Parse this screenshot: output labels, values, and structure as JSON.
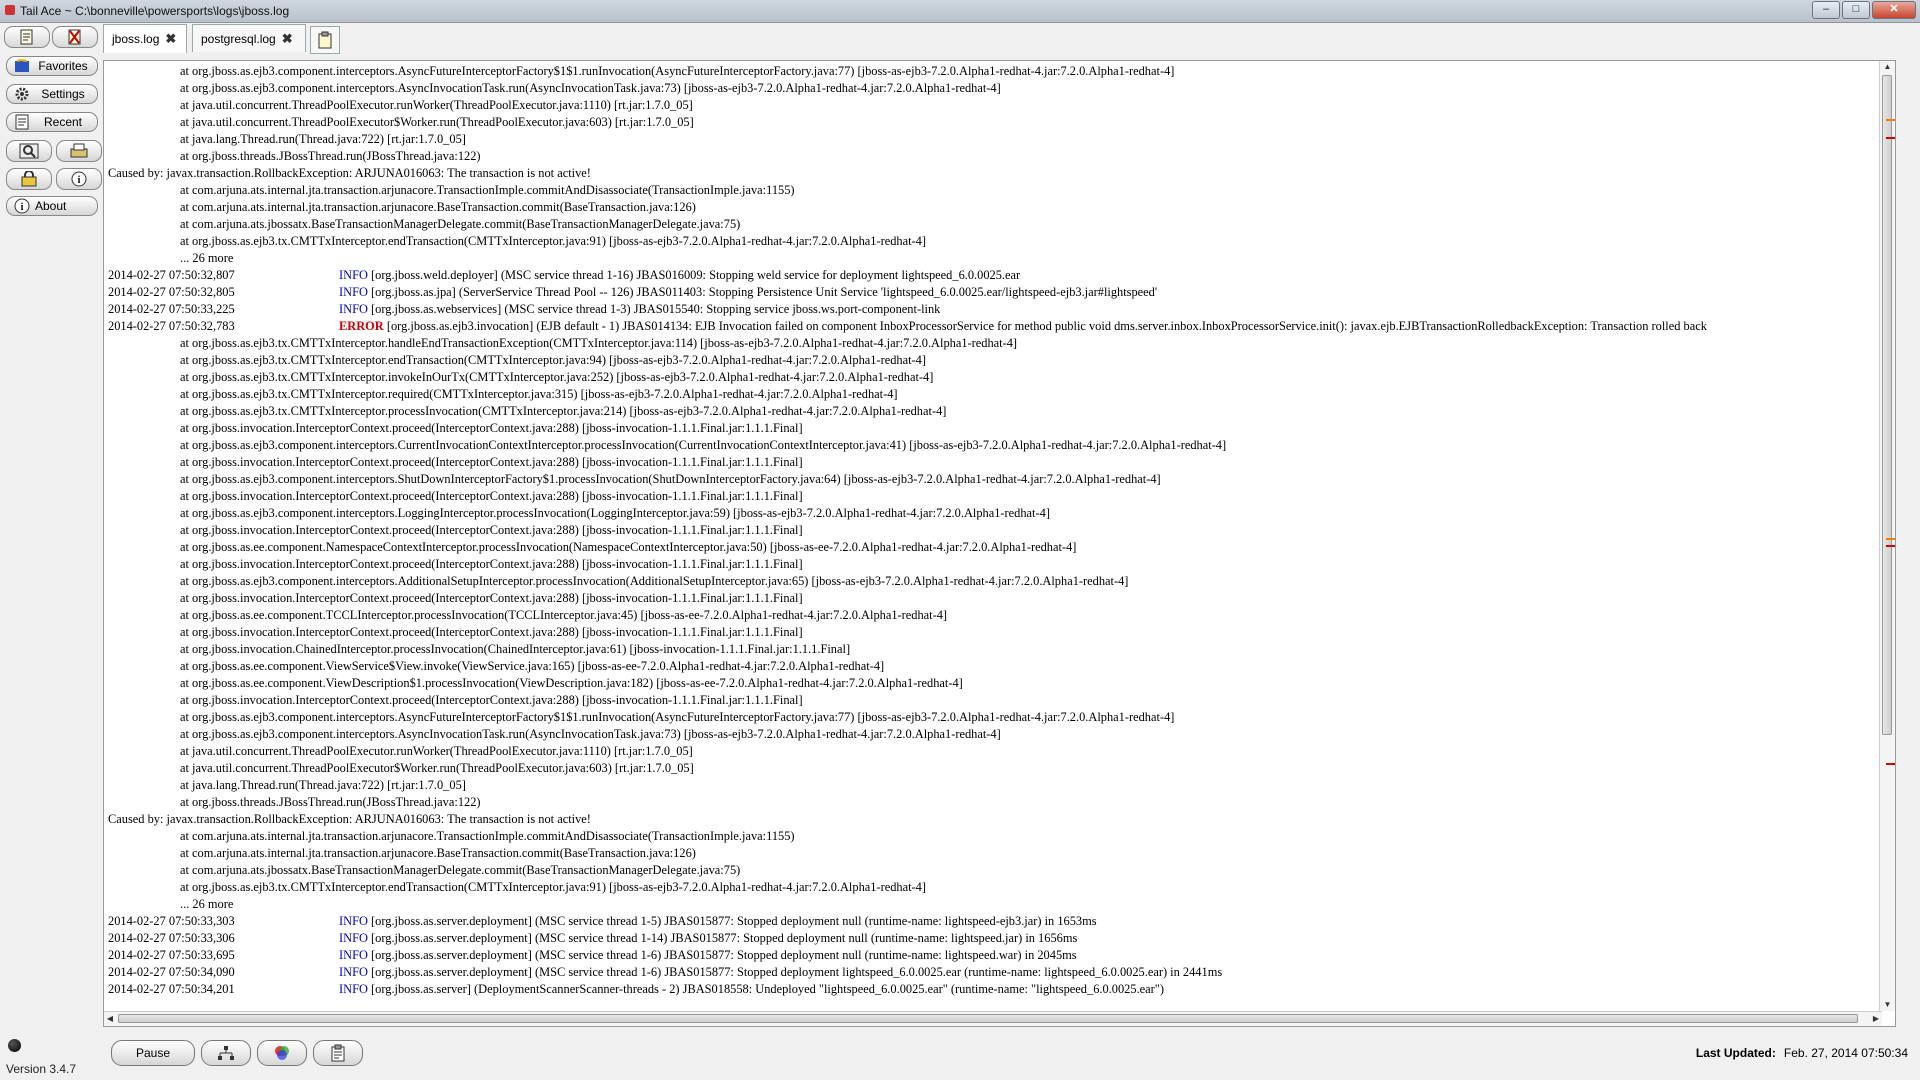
{
  "window": {
    "title": "Tail Ace ~ C:\\bonneville\\powersports\\logs\\jboss.log",
    "min": "–",
    "max": "□",
    "close": "✕"
  },
  "tabs": [
    {
      "label": "jboss.log",
      "close": "✖"
    },
    {
      "label": "postgresql.log",
      "close": "✖"
    }
  ],
  "sidebar": {
    "favorites": "Favorites",
    "settings": "Settings",
    "recent": "Recent",
    "about": "About",
    "version": "Version 3.4.7"
  },
  "bottom": {
    "pause": "Pause",
    "last_updated_label": "Last Updated:",
    "last_updated_value": "Feb. 27, 2014 07:50:34"
  },
  "log_lines": [
    {
      "type": "trace",
      "text": "at org.jboss.as.ejb3.component.interceptors.AsyncFutureInterceptorFactory$1$1.runInvocation(AsyncFutureInterceptorFactory.java:77) [jboss-as-ejb3-7.2.0.Alpha1-redhat-4.jar:7.2.0.Alpha1-redhat-4]"
    },
    {
      "type": "trace",
      "text": "at org.jboss.as.ejb3.component.interceptors.AsyncInvocationTask.run(AsyncInvocationTask.java:73) [jboss-as-ejb3-7.2.0.Alpha1-redhat-4.jar:7.2.0.Alpha1-redhat-4]"
    },
    {
      "type": "trace",
      "text": "at java.util.concurrent.ThreadPoolExecutor.runWorker(ThreadPoolExecutor.java:1110) [rt.jar:1.7.0_05]"
    },
    {
      "type": "trace",
      "text": "at java.util.concurrent.ThreadPoolExecutor$Worker.run(ThreadPoolExecutor.java:603) [rt.jar:1.7.0_05]"
    },
    {
      "type": "trace",
      "text": "at java.lang.Thread.run(Thread.java:722) [rt.jar:1.7.0_05]"
    },
    {
      "type": "trace",
      "text": "at org.jboss.threads.JBossThread.run(JBossThread.java:122)"
    },
    {
      "type": "plain",
      "text": "Caused by: javax.transaction.RollbackException: ARJUNA016063: The transaction is not active!"
    },
    {
      "type": "trace",
      "text": "at com.arjuna.ats.internal.jta.transaction.arjunacore.TransactionImple.commitAndDisassociate(TransactionImple.java:1155)"
    },
    {
      "type": "trace",
      "text": "at com.arjuna.ats.internal.jta.transaction.arjunacore.BaseTransaction.commit(BaseTransaction.java:126)"
    },
    {
      "type": "trace",
      "text": "at com.arjuna.ats.jbossatx.BaseTransactionManagerDelegate.commit(BaseTransactionManagerDelegate.java:75)"
    },
    {
      "type": "trace",
      "text": "at org.jboss.as.ejb3.tx.CMTTxInterceptor.endTransaction(CMTTxInterceptor.java:91) [jboss-as-ejb3-7.2.0.Alpha1-redhat-4.jar:7.2.0.Alpha1-redhat-4]"
    },
    {
      "type": "trace",
      "text": "... 26 more"
    },
    {
      "type": "entry",
      "ts": "2014-02-27 07:50:32,807",
      "level": "INFO",
      "msg": "[org.jboss.weld.deployer] (MSC service thread 1-16) JBAS016009: Stopping weld service for deployment lightspeed_6.0.0025.ear"
    },
    {
      "type": "entry",
      "ts": "2014-02-27 07:50:32,805",
      "level": "INFO",
      "msg": "[org.jboss.as.jpa] (ServerService Thread Pool -- 126) JBAS011403: Stopping Persistence Unit Service 'lightspeed_6.0.0025.ear/lightspeed-ejb3.jar#lightspeed'"
    },
    {
      "type": "entry",
      "ts": "2014-02-27 07:50:33,225",
      "level": "INFO",
      "msg": "[org.jboss.as.webservices] (MSC service thread 1-3) JBAS015540: Stopping service jboss.ws.port-component-link"
    },
    {
      "type": "entry",
      "ts": "2014-02-27 07:50:32,783",
      "level": "ERROR",
      "msg": "[org.jboss.as.ejb3.invocation] (EJB default - 1) JBAS014134: EJB Invocation failed on component InboxProcessorService for method public void dms.server.inbox.InboxProcessorService.init(): javax.ejb.EJBTransactionRolledbackException: Transaction rolled back"
    },
    {
      "type": "trace",
      "text": "at org.jboss.as.ejb3.tx.CMTTxInterceptor.handleEndTransactionException(CMTTxInterceptor.java:114) [jboss-as-ejb3-7.2.0.Alpha1-redhat-4.jar:7.2.0.Alpha1-redhat-4]"
    },
    {
      "type": "trace",
      "text": "at org.jboss.as.ejb3.tx.CMTTxInterceptor.endTransaction(CMTTxInterceptor.java:94) [jboss-as-ejb3-7.2.0.Alpha1-redhat-4.jar:7.2.0.Alpha1-redhat-4]"
    },
    {
      "type": "trace",
      "text": "at org.jboss.as.ejb3.tx.CMTTxInterceptor.invokeInOurTx(CMTTxInterceptor.java:252) [jboss-as-ejb3-7.2.0.Alpha1-redhat-4.jar:7.2.0.Alpha1-redhat-4]"
    },
    {
      "type": "trace",
      "text": "at org.jboss.as.ejb3.tx.CMTTxInterceptor.required(CMTTxInterceptor.java:315) [jboss-as-ejb3-7.2.0.Alpha1-redhat-4.jar:7.2.0.Alpha1-redhat-4]"
    },
    {
      "type": "trace",
      "text": "at org.jboss.as.ejb3.tx.CMTTxInterceptor.processInvocation(CMTTxInterceptor.java:214) [jboss-as-ejb3-7.2.0.Alpha1-redhat-4.jar:7.2.0.Alpha1-redhat-4]"
    },
    {
      "type": "trace",
      "text": "at org.jboss.invocation.InterceptorContext.proceed(InterceptorContext.java:288) [jboss-invocation-1.1.1.Final.jar:1.1.1.Final]"
    },
    {
      "type": "trace",
      "text": "at org.jboss.as.ejb3.component.interceptors.CurrentInvocationContextInterceptor.processInvocation(CurrentInvocationContextInterceptor.java:41) [jboss-as-ejb3-7.2.0.Alpha1-redhat-4.jar:7.2.0.Alpha1-redhat-4]"
    },
    {
      "type": "trace",
      "text": "at org.jboss.invocation.InterceptorContext.proceed(InterceptorContext.java:288) [jboss-invocation-1.1.1.Final.jar:1.1.1.Final]"
    },
    {
      "type": "trace",
      "text": "at org.jboss.as.ejb3.component.interceptors.ShutDownInterceptorFactory$1.processInvocation(ShutDownInterceptorFactory.java:64) [jboss-as-ejb3-7.2.0.Alpha1-redhat-4.jar:7.2.0.Alpha1-redhat-4]"
    },
    {
      "type": "trace",
      "text": "at org.jboss.invocation.InterceptorContext.proceed(InterceptorContext.java:288) [jboss-invocation-1.1.1.Final.jar:1.1.1.Final]"
    },
    {
      "type": "trace",
      "text": "at org.jboss.as.ejb3.component.interceptors.LoggingInterceptor.processInvocation(LoggingInterceptor.java:59) [jboss-as-ejb3-7.2.0.Alpha1-redhat-4.jar:7.2.0.Alpha1-redhat-4]"
    },
    {
      "type": "trace",
      "text": "at org.jboss.invocation.InterceptorContext.proceed(InterceptorContext.java:288) [jboss-invocation-1.1.1.Final.jar:1.1.1.Final]"
    },
    {
      "type": "trace",
      "text": "at org.jboss.as.ee.component.NamespaceContextInterceptor.processInvocation(NamespaceContextInterceptor.java:50) [jboss-as-ee-7.2.0.Alpha1-redhat-4.jar:7.2.0.Alpha1-redhat-4]"
    },
    {
      "type": "trace",
      "text": "at org.jboss.invocation.InterceptorContext.proceed(InterceptorContext.java:288) [jboss-invocation-1.1.1.Final.jar:1.1.1.Final]"
    },
    {
      "type": "trace",
      "text": "at org.jboss.as.ejb3.component.interceptors.AdditionalSetupInterceptor.processInvocation(AdditionalSetupInterceptor.java:65) [jboss-as-ejb3-7.2.0.Alpha1-redhat-4.jar:7.2.0.Alpha1-redhat-4]"
    },
    {
      "type": "trace",
      "text": "at org.jboss.invocation.InterceptorContext.proceed(InterceptorContext.java:288) [jboss-invocation-1.1.1.Final.jar:1.1.1.Final]"
    },
    {
      "type": "trace",
      "text": "at org.jboss.as.ee.component.TCCLInterceptor.processInvocation(TCCLInterceptor.java:45) [jboss-as-ee-7.2.0.Alpha1-redhat-4.jar:7.2.0.Alpha1-redhat-4]"
    },
    {
      "type": "trace",
      "text": "at org.jboss.invocation.InterceptorContext.proceed(InterceptorContext.java:288) [jboss-invocation-1.1.1.Final.jar:1.1.1.Final]"
    },
    {
      "type": "trace",
      "text": "at org.jboss.invocation.ChainedInterceptor.processInvocation(ChainedInterceptor.java:61) [jboss-invocation-1.1.1.Final.jar:1.1.1.Final]"
    },
    {
      "type": "trace",
      "text": "at org.jboss.as.ee.component.ViewService$View.invoke(ViewService.java:165) [jboss-as-ee-7.2.0.Alpha1-redhat-4.jar:7.2.0.Alpha1-redhat-4]"
    },
    {
      "type": "trace",
      "text": "at org.jboss.as.ee.component.ViewDescription$1.processInvocation(ViewDescription.java:182) [jboss-as-ee-7.2.0.Alpha1-redhat-4.jar:7.2.0.Alpha1-redhat-4]"
    },
    {
      "type": "trace",
      "text": "at org.jboss.invocation.InterceptorContext.proceed(InterceptorContext.java:288) [jboss-invocation-1.1.1.Final.jar:1.1.1.Final]"
    },
    {
      "type": "trace",
      "text": "at org.jboss.as.ejb3.component.interceptors.AsyncFutureInterceptorFactory$1$1.runInvocation(AsyncFutureInterceptorFactory.java:77) [jboss-as-ejb3-7.2.0.Alpha1-redhat-4.jar:7.2.0.Alpha1-redhat-4]"
    },
    {
      "type": "trace",
      "text": "at org.jboss.as.ejb3.component.interceptors.AsyncInvocationTask.run(AsyncInvocationTask.java:73) [jboss-as-ejb3-7.2.0.Alpha1-redhat-4.jar:7.2.0.Alpha1-redhat-4]"
    },
    {
      "type": "trace",
      "text": "at java.util.concurrent.ThreadPoolExecutor.runWorker(ThreadPoolExecutor.java:1110) [rt.jar:1.7.0_05]"
    },
    {
      "type": "trace",
      "text": "at java.util.concurrent.ThreadPoolExecutor$Worker.run(ThreadPoolExecutor.java:603) [rt.jar:1.7.0_05]"
    },
    {
      "type": "trace",
      "text": "at java.lang.Thread.run(Thread.java:722) [rt.jar:1.7.0_05]"
    },
    {
      "type": "trace",
      "text": "at org.jboss.threads.JBossThread.run(JBossThread.java:122)"
    },
    {
      "type": "plain",
      "text": "Caused by: javax.transaction.RollbackException: ARJUNA016063: The transaction is not active!"
    },
    {
      "type": "trace",
      "text": "at com.arjuna.ats.internal.jta.transaction.arjunacore.TransactionImple.commitAndDisassociate(TransactionImple.java:1155)"
    },
    {
      "type": "trace",
      "text": "at com.arjuna.ats.internal.jta.transaction.arjunacore.BaseTransaction.commit(BaseTransaction.java:126)"
    },
    {
      "type": "trace",
      "text": "at com.arjuna.ats.jbossatx.BaseTransactionManagerDelegate.commit(BaseTransactionManagerDelegate.java:75)"
    },
    {
      "type": "trace",
      "text": "at org.jboss.as.ejb3.tx.CMTTxInterceptor.endTransaction(CMTTxInterceptor.java:91) [jboss-as-ejb3-7.2.0.Alpha1-redhat-4.jar:7.2.0.Alpha1-redhat-4]"
    },
    {
      "type": "trace",
      "text": "... 26 more"
    },
    {
      "type": "entry",
      "ts": "2014-02-27 07:50:33,303",
      "level": "INFO",
      "msg": "[org.jboss.as.server.deployment] (MSC service thread 1-5) JBAS015877: Stopped deployment null (runtime-name: lightspeed-ejb3.jar) in 1653ms"
    },
    {
      "type": "entry",
      "ts": "2014-02-27 07:50:33,306",
      "level": "INFO",
      "msg": "[org.jboss.as.server.deployment] (MSC service thread 1-14) JBAS015877: Stopped deployment null (runtime-name: lightspeed.jar) in 1656ms"
    },
    {
      "type": "entry",
      "ts": "2014-02-27 07:50:33,695",
      "level": "INFO",
      "msg": "[org.jboss.as.server.deployment] (MSC service thread 1-6) JBAS015877: Stopped deployment null (runtime-name: lightspeed.war) in 2045ms"
    },
    {
      "type": "entry",
      "ts": "2014-02-27 07:50:34,090",
      "level": "INFO",
      "msg": "[org.jboss.as.server.deployment] (MSC service thread 1-6) JBAS015877: Stopped deployment lightspeed_6.0.0025.ear (runtime-name: lightspeed_6.0.0025.ear) in 2441ms"
    },
    {
      "type": "entry",
      "ts": "2014-02-27 07:50:34,201",
      "level": "INFO",
      "msg": "[org.jboss.as.server] (DeploymentScannerScanner-threads - 2) JBAS018558: Undeployed \"lightspeed_6.0.0025.ear\" (runtime-name: \"lightspeed_6.0.0025.ear\")"
    }
  ],
  "colors": {
    "info": "#0000c8",
    "error": "#d40000",
    "marker_orange": "#f08000",
    "marker_red": "#d40000"
  }
}
